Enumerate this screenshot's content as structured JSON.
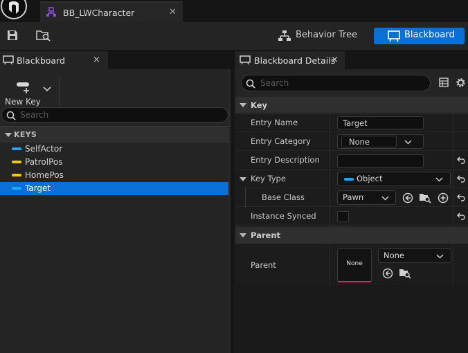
{
  "app": {
    "document_tab": "BB_LWCharacter"
  },
  "toolbar": {
    "behavior_tree_label": "Behavior Tree",
    "blackboard_label": "Blackboard"
  },
  "blackboard_panel": {
    "tab_label": "Blackboard",
    "close_glyph": "×",
    "new_key_label": "New Key",
    "search_placeholder": "Search",
    "keys_header": "KEYS",
    "keys": [
      {
        "name": "SelfActor",
        "color": "#1aa9f2"
      },
      {
        "name": "PatrolPos",
        "color": "#f5c518"
      },
      {
        "name": "HomePos",
        "color": "#f5c518"
      },
      {
        "name": "Target",
        "color": "#1aa9f2",
        "selected": true
      }
    ]
  },
  "details_panel": {
    "tab_label": "Blackboard Details",
    "close_glyph": "×",
    "search_placeholder": "Search",
    "key_category": "Key",
    "entry_name_label": "Entry Name",
    "entry_name_value": "Target",
    "entry_category_label": "Entry Category",
    "entry_category_value": "None",
    "entry_description_label": "Entry Description",
    "entry_description_value": "",
    "key_type_label": "Key Type",
    "key_type_value": "Object",
    "key_type_color": "#1aa9f2",
    "base_class_label": "Base Class",
    "base_class_value": "Pawn",
    "instance_synced_label": "Instance Synced",
    "instance_synced_checked": false,
    "parent_category": "Parent",
    "parent_label": "Parent",
    "parent_thumb_text": "None",
    "parent_value": "None"
  },
  "colors": {
    "accent": "#0a6fd6",
    "asset_underline": "#d4245b",
    "tab_icon": "#8e4bd6"
  }
}
